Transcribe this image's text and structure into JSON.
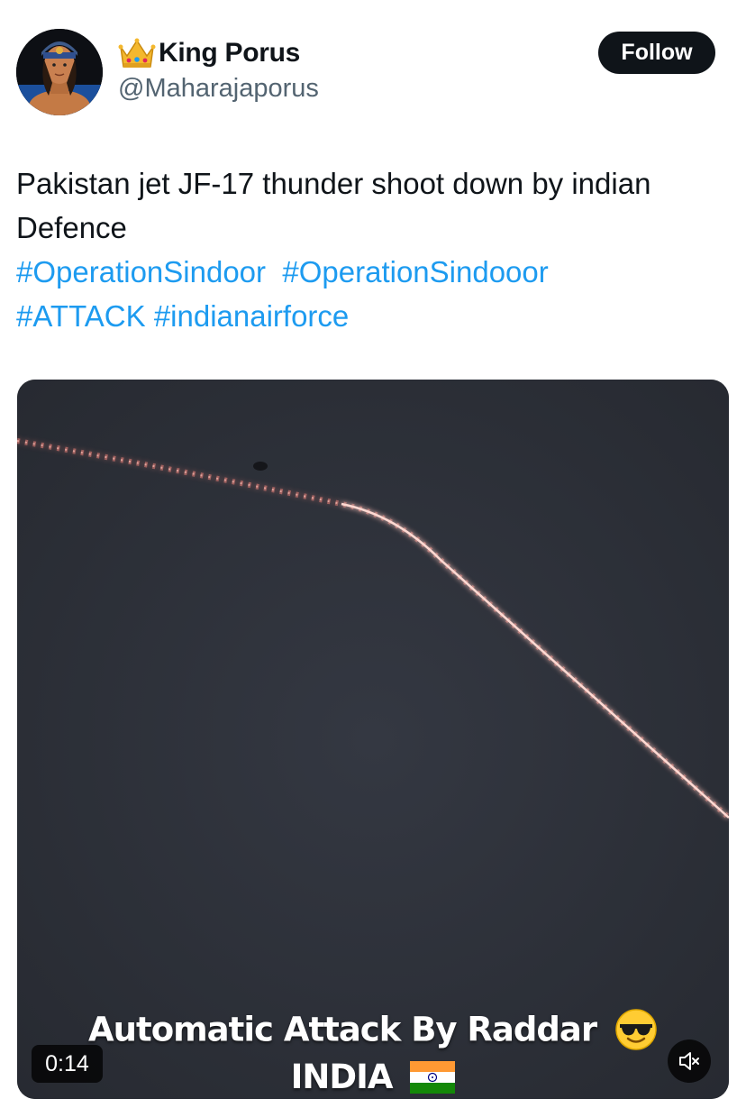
{
  "author": {
    "name": "King Porus",
    "handle": "@Maharajaporus",
    "avatar_icon": "profile-avatar",
    "name_emoji_icon": "crown-icon"
  },
  "follow_button": {
    "label": "Follow"
  },
  "tweet": {
    "line1": "Pakistan jet JF-17 thunder shoot down by indian Defence",
    "hashtags_row1": [
      "#OperationSindoor",
      "#OperationSindooor"
    ],
    "hashtags_row2": [
      "#ATTACK",
      "#indianairforce"
    ]
  },
  "media": {
    "caption_line1": "Automatic Attack By Raddar",
    "caption_line1_emoji": "sunglasses-face-icon",
    "caption_line2": "INDIA",
    "caption_line2_emoji": "india-flag-icon",
    "duration": "0:14",
    "mute_icon": "muted-speaker-icon"
  },
  "colors": {
    "hashtag": "#1d9bf0",
    "follow_bg": "#0f1419",
    "handle": "#536471",
    "video_bg": "#2f323a",
    "streak": "#ff8a80"
  }
}
